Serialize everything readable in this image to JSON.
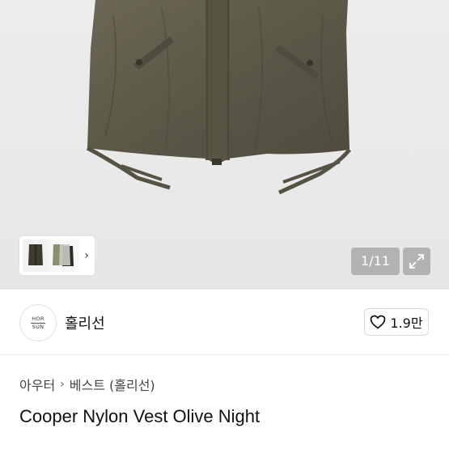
{
  "gallery": {
    "counter": "1/11",
    "icons": {
      "expand": "expand-icon",
      "next": "chevron-right-icon"
    },
    "colors": {
      "vest": "#5f5a4c",
      "overlay": "#969696"
    }
  },
  "shop": {
    "logo_lines": [
      "HOR",
      "SUN"
    ],
    "name": "홀리선",
    "like_count": "1.9만",
    "like_icon": "heart-outline-icon"
  },
  "breadcrumb": {
    "items": [
      "아우터",
      "베스트 (홀리선)"
    ],
    "separator_icon": "chevron-right-icon"
  },
  "product": {
    "title": "Cooper Nylon Vest Olive Night"
  }
}
